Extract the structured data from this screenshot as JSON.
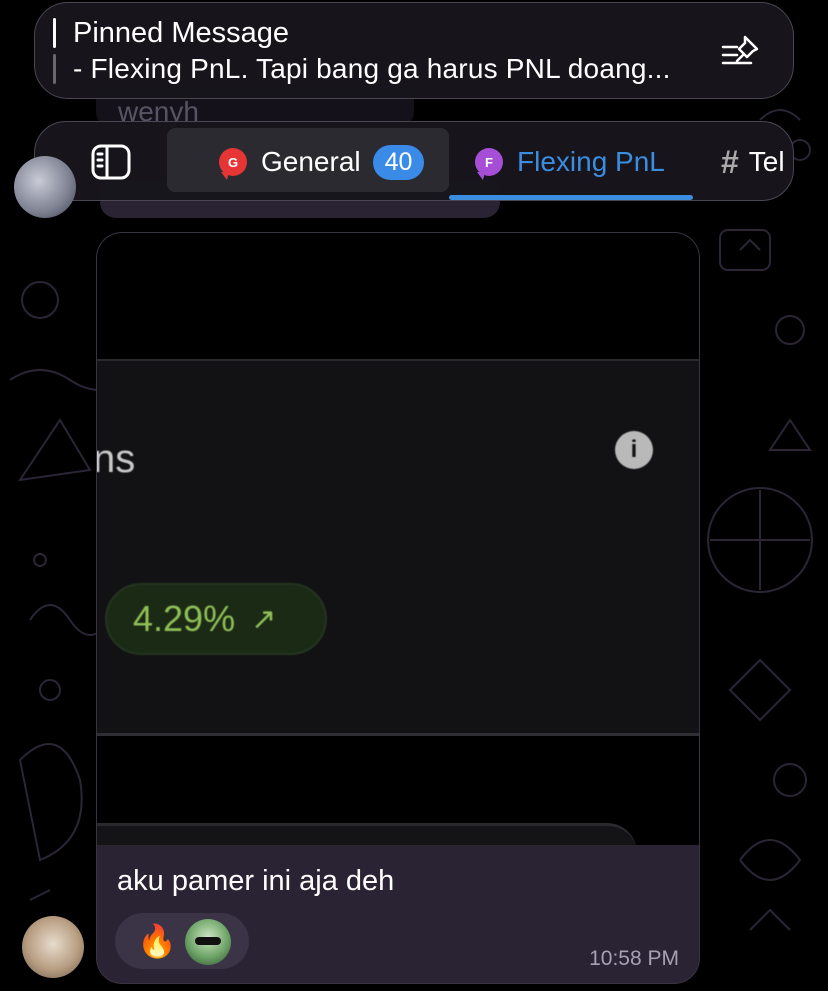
{
  "pinned": {
    "title": "Pinned Message",
    "text": "- Flexing PnL. Tapi bang ga harus PNL doang...",
    "icon": "pin-list-icon"
  },
  "behind": {
    "name": "wenyh"
  },
  "tabs": {
    "sidebar_icon": "sidebar-toggle-icon",
    "items": [
      {
        "label": "General",
        "icon_letter": "G",
        "badge": "40",
        "active": false
      },
      {
        "label": "Flexing PnL",
        "icon_letter": "F",
        "active": true
      },
      {
        "label": "Tel",
        "icon": "hash-icon",
        "active": false
      }
    ]
  },
  "message": {
    "photo": {
      "label_fragment": "ns",
      "info_glyph": "i",
      "percent": "4.29%",
      "arrow": "↗"
    },
    "text": "aku pamer ini aja deh",
    "reaction_emoji": "🔥",
    "time": "10:58 PM"
  },
  "colors": {
    "accent": "#3b8de0",
    "bubble": "#2a2333",
    "badge": "#3a8be8",
    "gain_green": "#8fbf57"
  }
}
